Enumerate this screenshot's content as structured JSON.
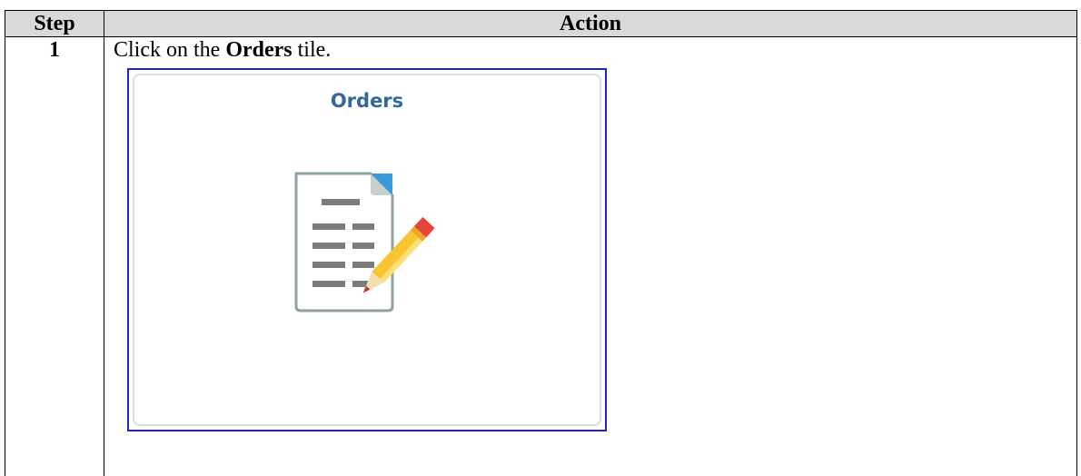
{
  "table": {
    "headers": {
      "step": "Step",
      "action": "Action"
    },
    "rows": [
      {
        "step": "1",
        "instruction_prefix": "Click on the ",
        "instruction_bold": "Orders",
        "instruction_suffix": " tile."
      }
    ]
  },
  "tile": {
    "title": "Orders",
    "icon": "orders-document-pencil-icon",
    "title_color": "#33689c",
    "highlight_border_color": "#2323c8"
  }
}
